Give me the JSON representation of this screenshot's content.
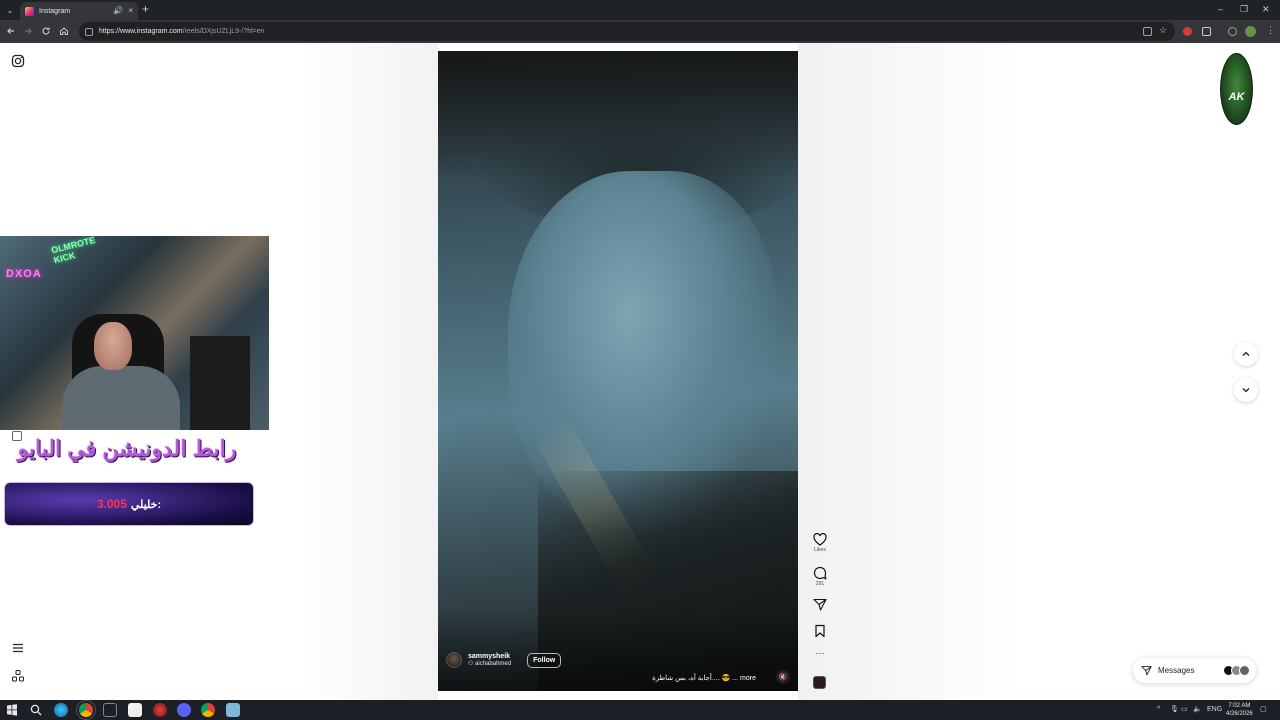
{
  "browser": {
    "tab_title": "Instagram",
    "tab_audio": "🔊",
    "tab_close": "×",
    "new_tab": "+",
    "url_host": "https://www.instagram.com",
    "url_path": "/reels/DXjsUZLjL9-/?hl=en",
    "window_controls": {
      "minimize": "–",
      "maximize": "❐",
      "close": "✕"
    }
  },
  "sidebar": {
    "instagram_icon": "instagram-icon",
    "more_icon": "hamburger-icon",
    "also_from_meta_icon": "meta-apps-icon"
  },
  "reel": {
    "author": "sammysheik",
    "collab": "aichabahmed",
    "follow_label": "Follow",
    "caption": "أجابة آه، بس شاطرة.... 😎 ... more",
    "mute_icon": "🔇"
  },
  "actions": {
    "like_label": "Likes",
    "comment_count": "291",
    "share_icon": "send-icon",
    "save_icon": "bookmark-icon",
    "more_label": "···"
  },
  "messages": {
    "label": "Messages"
  },
  "overlay": {
    "logo_text": "AK",
    "banner_text": "رابط الدونيشن في البايو",
    "bar_text": "خليلي:",
    "bar_number": "3.005",
    "neon_a": "DXOA",
    "neon_b": "OLMROTE\nKICK"
  },
  "taskbar": {
    "language": "ENG",
    "time": "7:02 AM",
    "date": "4/26/2026"
  }
}
